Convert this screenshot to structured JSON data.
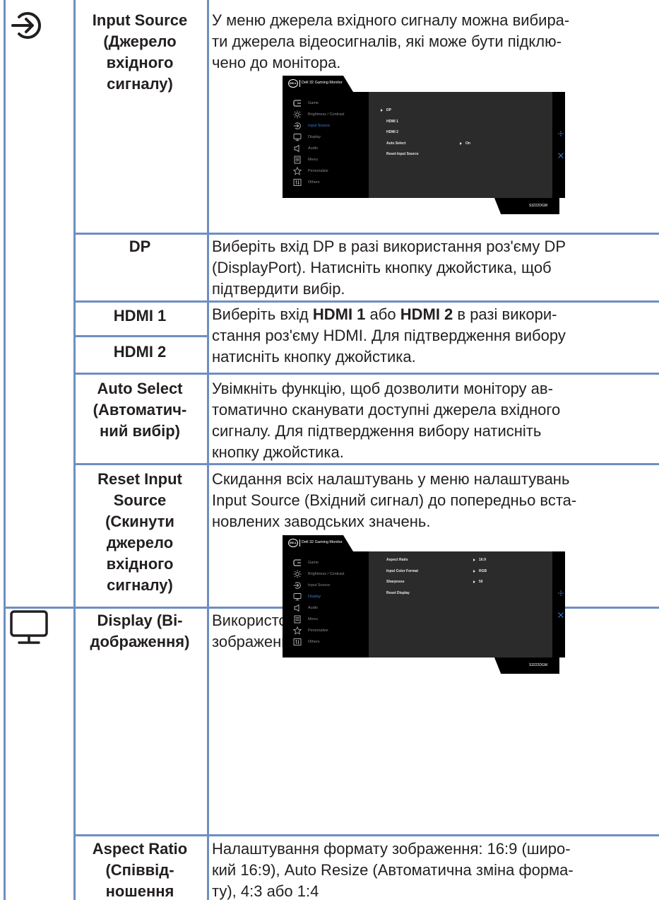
{
  "rows": {
    "input_source": {
      "name": "Input Source\n(Джерело\nвхідного\nсигналу)",
      "desc": "У меню джерела вхідного сигналу можна вибира-\nти джерела відеосигналів, які може бути підклю-\nчено до монітора."
    },
    "dp": {
      "name": "DP",
      "desc": "Виберіть вхід DP в разі використання роз'єму DP\n(DisplayPort). Натисніть кнопку джойстика, щоб\nпідтвердити вибір."
    },
    "hdmi1": {
      "name": "HDMI 1"
    },
    "hdmi2": {
      "name": "HDMI 2"
    },
    "hdmi_desc": {
      "pre": "Виберіть вхід ",
      "b1": "HDMI 1",
      "mid": " або ",
      "b2": "HDMI 2",
      "post": " в разі викори-\nстання роз'єму HDMI. Для підтвердження вибору\nнатисніть кнопку джойстика."
    },
    "auto_select": {
      "name": "Auto Select\n(Автоматич-\nний вибір)",
      "desc": "Увімкніть функцію, щоб дозволити монітору ав-\nтоматично сканувати доступні джерела вхідного\nсигналу. Для підтвердження вибору натисніть\nкнопку джойстика."
    },
    "reset_input": {
      "name": "Reset Input\nSource\n(Скинути\nджерело\nвхідного\nсигналу)",
      "desc": "Скидання всіх налаштувань у меню налаштувань\nInput Source (Вхідний сигнал) до попередньо вста-\nновлених заводських значень."
    },
    "display": {
      "name": "Display (Ві-\nдображення)",
      "desc": "Використовуйте цю опцію, щоб налаштувати\nзображення."
    },
    "aspect_ratio": {
      "name": "Aspect Ratio\n(Співвід-\nношення\nсторін)",
      "desc": "Налаштування формату зображення: 16:9 (широ-\nкий 16:9), Auto Resize (Автоматична зміна форма-\nту), 4:3 або 1:4"
    }
  },
  "osd_common": {
    "model_title": "Dell 32 Gaming Monitor",
    "logo": "DELL",
    "footer_model": "S3222DGM",
    "menu": [
      "Game",
      "Brightness / Contrast",
      "Input Source",
      "Display",
      "Audio",
      "Menu",
      "Personalize",
      "Others"
    ],
    "active_color": "#3b7fd4"
  },
  "osd_input": {
    "active_item": "Input Source",
    "items": [
      "DP",
      "HDMI 1",
      "HDMI 2",
      "Auto Select",
      "Reset Input Source"
    ],
    "auto_select_value": "On"
  },
  "osd_display": {
    "active_item": "Display",
    "items": [
      "Aspect Ratio",
      "Input Color Format",
      "Sharpness",
      "Reset Display"
    ],
    "values": [
      "16:9",
      "RGB",
      "50"
    ]
  }
}
